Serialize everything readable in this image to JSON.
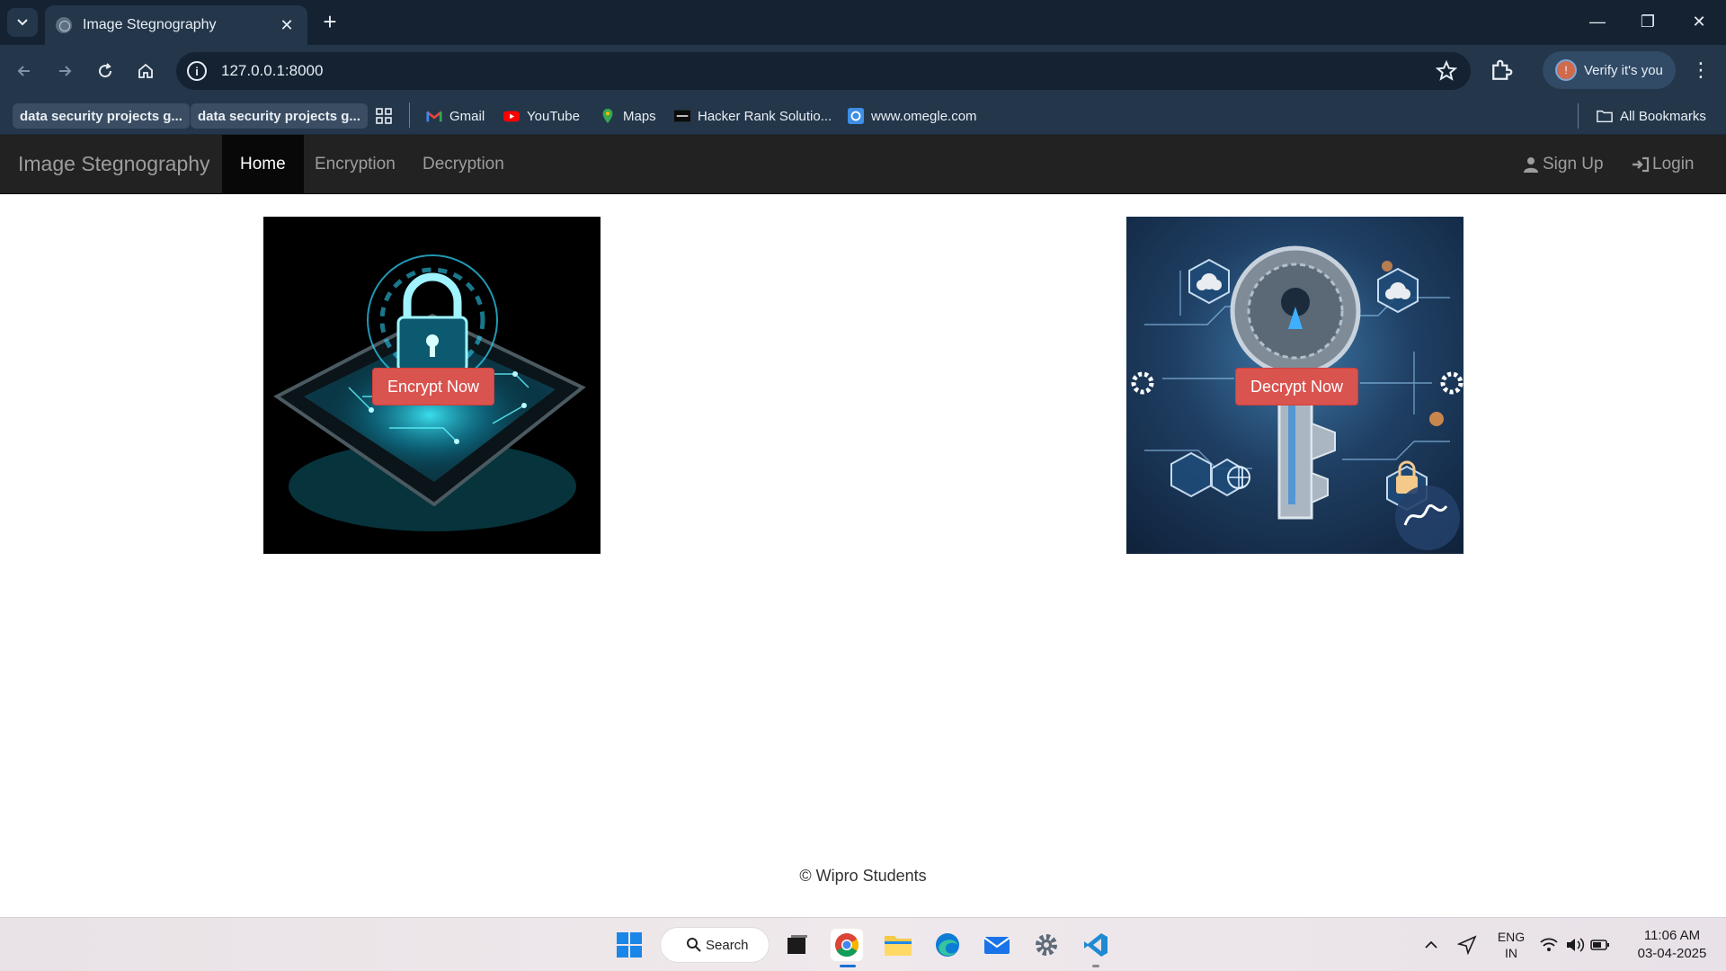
{
  "browser": {
    "tab_title": "Image Stegnography",
    "url": "127.0.0.1:8000",
    "profile_label": "Verify it's you",
    "bookmarks": [
      "data security projects g...",
      "data security projects g...",
      "Gmail",
      "YouTube",
      "Maps",
      "Hacker Rank Solutio...",
      "www.omegle.com"
    ],
    "all_bookmarks": "All Bookmarks"
  },
  "navbar": {
    "brand": "Image Stegnography",
    "items": [
      "Home",
      "Encryption",
      "Decryption"
    ],
    "active": "Home",
    "signup": "Sign Up",
    "login": "Login"
  },
  "cards": {
    "encrypt_label": "Encrypt Now",
    "decrypt_label": "Decrypt Now"
  },
  "footer": {
    "text": "© Wipro Students"
  },
  "taskbar": {
    "search_label": "Search",
    "lang_top": "ENG",
    "lang_bottom": "IN",
    "time": "11:06 AM",
    "date": "03-04-2025"
  },
  "colors": {
    "navbar_bg": "#222222",
    "cta_red": "#d9534f",
    "chrome_dark": "#142232",
    "chrome_mid": "#24364a"
  }
}
